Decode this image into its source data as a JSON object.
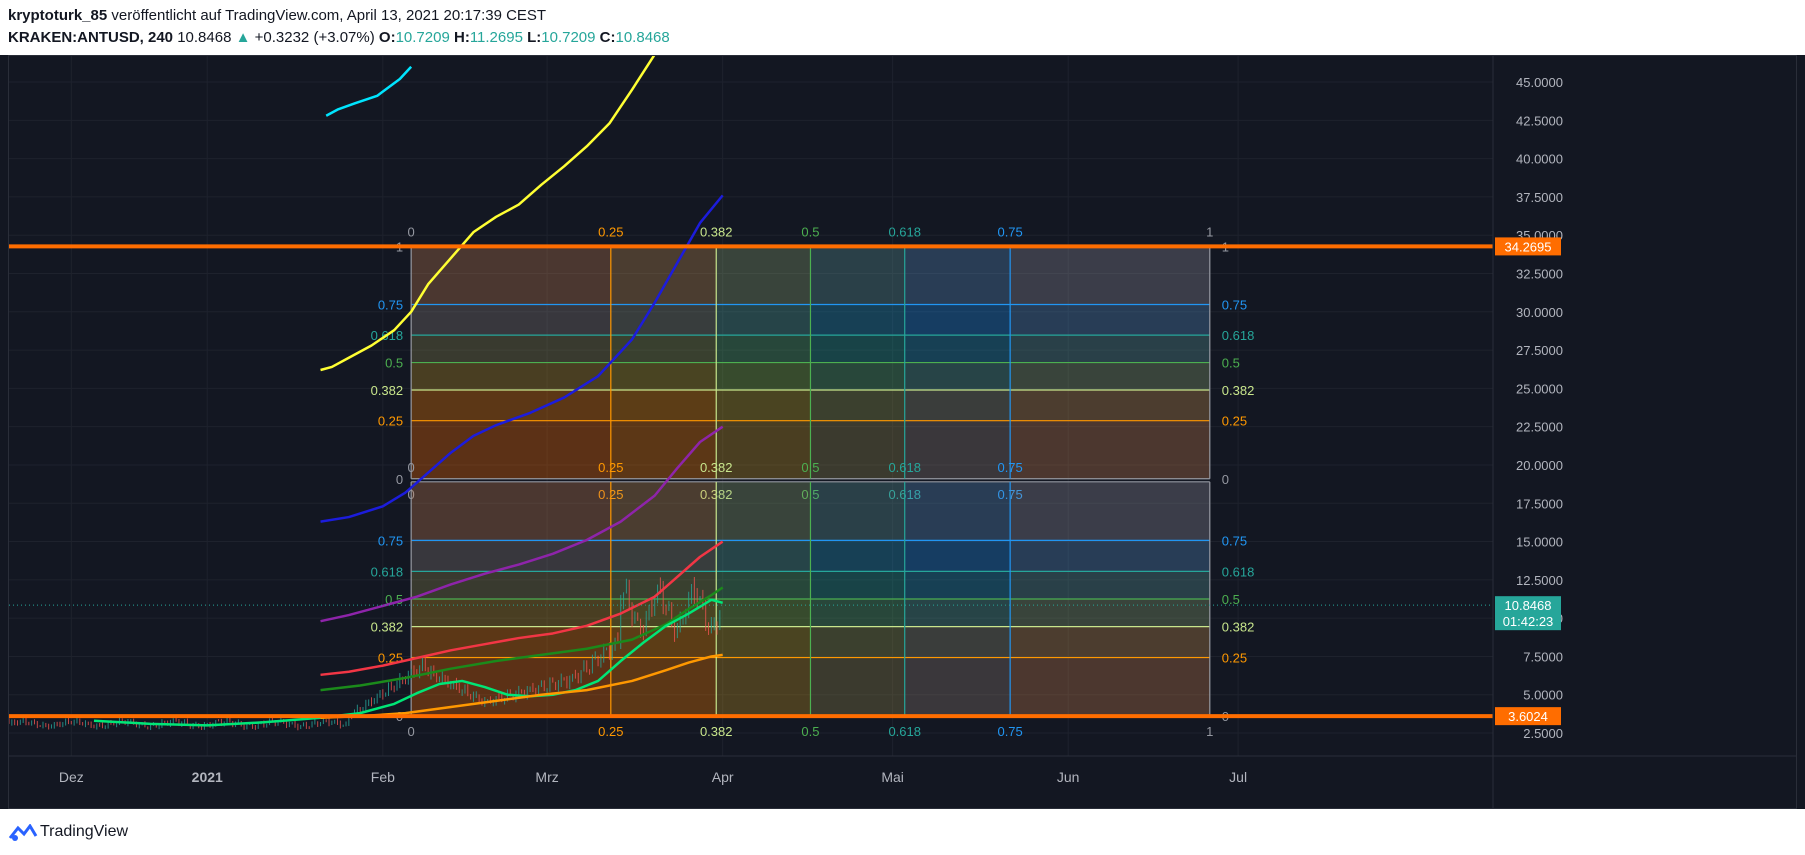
{
  "header": {
    "author": "kryptoturk_85",
    "published": "veröffentlicht auf TradingView.com, April 13, 2021 20:17:39 CEST",
    "symbol": "KRAKEN:ANTUSD, 240",
    "last": "10.8468",
    "change": "+0.3232 (+3.07%)",
    "o_label": "O:",
    "o": "10.7209",
    "h_label": "H:",
    "h": "11.2695",
    "l_label": "L:",
    "l": "10.7209",
    "c_label": "C:",
    "c": "10.8468",
    "up_arrow": "▲"
  },
  "footer": {
    "brand": "TradingView",
    "logo_icon": "tradingview-logo-icon"
  },
  "colors": {
    "background": "#131722",
    "grid": "#1e222d",
    "axis_text": "#b2b5be",
    "hline": "#ff6d00",
    "price_badge": "#26a69a"
  },
  "chart_data": {
    "type": "line",
    "title": "",
    "x_ticks": [
      "Dez",
      "2021",
      "Feb",
      "Mrz",
      "Apr",
      "Mai",
      "Jun",
      "Jul"
    ],
    "y_ticks": [
      "2.5000",
      "5.0000",
      "7.5000",
      "10.0000",
      "12.5000",
      "15.0000",
      "17.5000",
      "20.0000",
      "22.5000",
      "25.0000",
      "27.5000",
      "30.0000",
      "32.5000",
      "35.0000",
      "37.5000",
      "40.0000",
      "42.5000",
      "45.0000"
    ],
    "ylim": [
      1.0,
      46.7
    ],
    "xlim_day": [
      0,
      262
    ],
    "x_tick_days": [
      11,
      35,
      66,
      95,
      126,
      156,
      187,
      217
    ],
    "horizontal_lines": [
      {
        "price": 34.2695,
        "label": "34.2695"
      },
      {
        "price": 3.6024,
        "label": "3.6024"
      }
    ],
    "last_price": {
      "price": 10.8468,
      "label": "10.8468",
      "countdown": "01:42:23"
    },
    "fib_grids": [
      {
        "x_start_day": 71,
        "x_end_day": 212,
        "price_low": 19.1,
        "price_high": 34.27,
        "level_labels": [
          "0",
          "0.25",
          "0.382",
          "0.5",
          "0.618",
          "0.75",
          "1"
        ],
        "levels": [
          0,
          0.25,
          0.382,
          0.5,
          0.618,
          0.75,
          1
        ],
        "left_labels": [
          "0",
          "0.25",
          "0.382",
          "0.5",
          "0.618",
          "0.75",
          "1"
        ],
        "right_labels": [
          "0",
          "0.25",
          "0.382",
          "0.5",
          "0.618",
          "0.75",
          "1"
        ],
        "top_labels": [
          "0",
          "0.25",
          "0.382",
          "0.5",
          "0.618",
          "0.75",
          "1"
        ],
        "bottom_labels": [
          "0",
          "0.25",
          "0.382",
          "0.5",
          "0.618",
          "0.75"
        ]
      },
      {
        "x_start_day": 71,
        "x_end_day": 212,
        "price_low": 3.6,
        "price_high": 18.9,
        "level_labels": [
          "0",
          "0.25",
          "0.382",
          "0.5",
          "0.618",
          "0.75",
          "1"
        ],
        "levels": [
          0,
          0.25,
          0.382,
          0.5,
          0.618,
          0.75,
          1
        ],
        "left_labels": [
          "0",
          "0.25",
          "0.382",
          "0.5",
          "0.618",
          "0.75"
        ],
        "right_labels": [
          "0",
          "0.25",
          "0.382",
          "0.5",
          "0.618",
          "0.75"
        ],
        "top_labels": [
          "0",
          "0.25",
          "0.382",
          "0.5",
          "0.618",
          "0.75"
        ],
        "bottom_labels": [
          "0",
          "0.25",
          "0.382",
          "0.5",
          "0.618",
          "0.75",
          "1"
        ]
      }
    ],
    "level_colors": {
      "0": "#9598a1",
      "0.25": "#ff9800",
      "0.382": "#c8e68c",
      "0.5": "#4caf50",
      "0.618": "#26a69a",
      "0.75": "#2196f3",
      "1": "#9598a1"
    },
    "series": [
      {
        "color": "#00e5ff",
        "x": [
          56,
          58,
          61,
          65,
          69,
          71
        ],
        "y": [
          42.8,
          43.2,
          43.6,
          44.1,
          45.2,
          46.0
        ]
      },
      {
        "color": "#ffff33",
        "x": [
          55,
          57,
          60,
          64,
          68,
          71,
          74,
          78,
          82,
          86,
          90,
          94,
          98,
          102,
          106,
          110,
          114,
          117,
          120
        ],
        "y": [
          26.2,
          26.4,
          27.0,
          27.8,
          28.8,
          30.0,
          31.8,
          33.5,
          35.2,
          36.2,
          37.0,
          38.3,
          39.5,
          40.8,
          42.3,
          44.5,
          46.8,
          49.5,
          53.0
        ]
      },
      {
        "color": "#1c1cdc",
        "x": [
          55,
          60,
          66,
          70,
          74,
          78,
          82,
          86,
          92,
          98,
          104,
          110,
          114,
          118,
          122,
          126
        ],
        "y": [
          16.3,
          16.6,
          17.3,
          18.2,
          19.5,
          20.8,
          21.9,
          22.6,
          23.4,
          24.4,
          25.8,
          28.2,
          30.6,
          33.2,
          35.8,
          37.6
        ]
      },
      {
        "color": "#8e24aa",
        "x": [
          55,
          60,
          66,
          72,
          78,
          84,
          90,
          96,
          102,
          108,
          114,
          118,
          122,
          126
        ],
        "y": [
          9.8,
          10.2,
          10.8,
          11.4,
          12.2,
          12.9,
          13.5,
          14.2,
          15.1,
          16.3,
          18.0,
          19.8,
          21.5,
          22.5
        ]
      },
      {
        "color": "#f23645",
        "x": [
          55,
          60,
          66,
          72,
          78,
          84,
          90,
          96,
          102,
          108,
          114,
          118,
          122,
          126
        ],
        "y": [
          6.3,
          6.5,
          6.9,
          7.4,
          7.9,
          8.3,
          8.7,
          9.0,
          9.5,
          10.3,
          11.4,
          12.7,
          14.0,
          15.0
        ]
      },
      {
        "color": "#1b8a1b",
        "x": [
          55,
          62,
          70,
          78,
          86,
          94,
          102,
          110,
          116,
          120,
          124,
          126
        ],
        "y": [
          5.3,
          5.6,
          6.1,
          6.7,
          7.2,
          7.6,
          8.0,
          8.6,
          9.6,
          10.6,
          11.5,
          12.0
        ]
      },
      {
        "color": "#00e676",
        "x": [
          15,
          25,
          35,
          45,
          55,
          62,
          68,
          72,
          76,
          80,
          84,
          88,
          92,
          96,
          100,
          104,
          108,
          112,
          116,
          120,
          124,
          126
        ],
        "y": [
          3.3,
          3.1,
          3.0,
          3.2,
          3.5,
          3.8,
          4.4,
          5.1,
          5.7,
          5.9,
          5.5,
          5.0,
          4.9,
          5.0,
          5.3,
          5.9,
          7.2,
          8.4,
          9.5,
          10.3,
          11.2,
          11.0
        ]
      },
      {
        "color": "#ff9800",
        "x": [
          55,
          62,
          70,
          78,
          86,
          94,
          102,
          110,
          116,
          120,
          124,
          126
        ],
        "y": [
          3.5,
          3.6,
          3.8,
          4.2,
          4.6,
          5.0,
          5.3,
          5.9,
          6.6,
          7.1,
          7.5,
          7.6
        ]
      }
    ],
    "candles_note": ""
  }
}
